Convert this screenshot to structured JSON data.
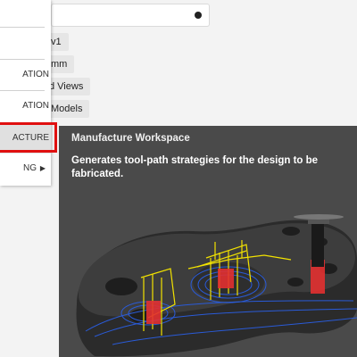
{
  "browser": {
    "items": [
      "v1",
      "mm",
      "d Views",
      "Models"
    ]
  },
  "menu": {
    "items": [
      {
        "label": "",
        "has_submenu": false
      },
      {
        "label": "",
        "has_submenu": false
      },
      {
        "label": "ATION",
        "has_submenu": false
      },
      {
        "label": "ATION",
        "has_submenu": false
      },
      {
        "label": "ACTURE",
        "has_submenu": false,
        "selected": true
      },
      {
        "label": "NG",
        "has_submenu": true
      }
    ]
  },
  "tooltip": {
    "title": "Manufacture Workspace",
    "description": "Generates tool-path strategies for the design to be fabricated."
  },
  "colors": {
    "highlight": "#e01010",
    "tooltip_bg": "#4a4a4a"
  }
}
